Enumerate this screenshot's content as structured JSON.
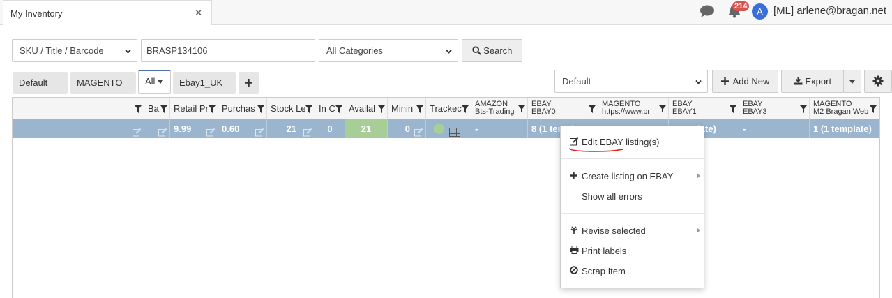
{
  "tab": {
    "title": "My Inventory"
  },
  "header": {
    "notifications": "214",
    "avatar_letter": "A",
    "user": "[ML] arlene@bragan.net"
  },
  "filters": {
    "search_type": "SKU / Title / Barcode",
    "search_value": "BRASP134106",
    "category": "All Categories",
    "search_label": "Search"
  },
  "views": {
    "default": "Default",
    "magento": "MAGENTO",
    "all": "All",
    "ebay": "Ebay1_UK",
    "view_select": "Default",
    "add_new": "Add New",
    "export": "Export"
  },
  "columns": [
    {
      "label": ""
    },
    {
      "label": "Ba"
    },
    {
      "label": "Retail Pr"
    },
    {
      "label": "Purchas"
    },
    {
      "label": "Stock Le"
    },
    {
      "label": "In C"
    },
    {
      "label": "Availal"
    },
    {
      "label": "Minin"
    },
    {
      "label": "Trackec"
    },
    {
      "line1": "AMAZON",
      "line2": "Bts-Trading"
    },
    {
      "line1": "EBAY",
      "line2": "EBAY0"
    },
    {
      "line1": "MAGENTO",
      "line2": "https://www.br"
    },
    {
      "line1": "EBAY",
      "line2": "EBAY1"
    },
    {
      "line1": "EBAY",
      "line2": "EBAY3"
    },
    {
      "line1": "MAGENTO",
      "line2": "M2 Bragan Web"
    }
  ],
  "row": {
    "retail": "9.99",
    "purchase": "0.60",
    "stock": "21",
    "in_c": "0",
    "available": "21",
    "minimum": "0",
    "amazon": "-",
    "ebay0": "8 (1 templ",
    "ebay1": "template)",
    "ebay3": "-",
    "magento2": "1 (1 template)"
  },
  "context_menu": {
    "edit": "Edit EBAY listing(s)",
    "create": "Create listing on EBAY",
    "errors": "Show all errors",
    "revise": "Revise selected",
    "print": "Print labels",
    "scrap": "Scrap Item"
  },
  "colors": {
    "row_selected": "#9bb5cf",
    "available_cell": "#a8ce97",
    "badge": "#d9534f",
    "accent": "#4a76a8"
  }
}
